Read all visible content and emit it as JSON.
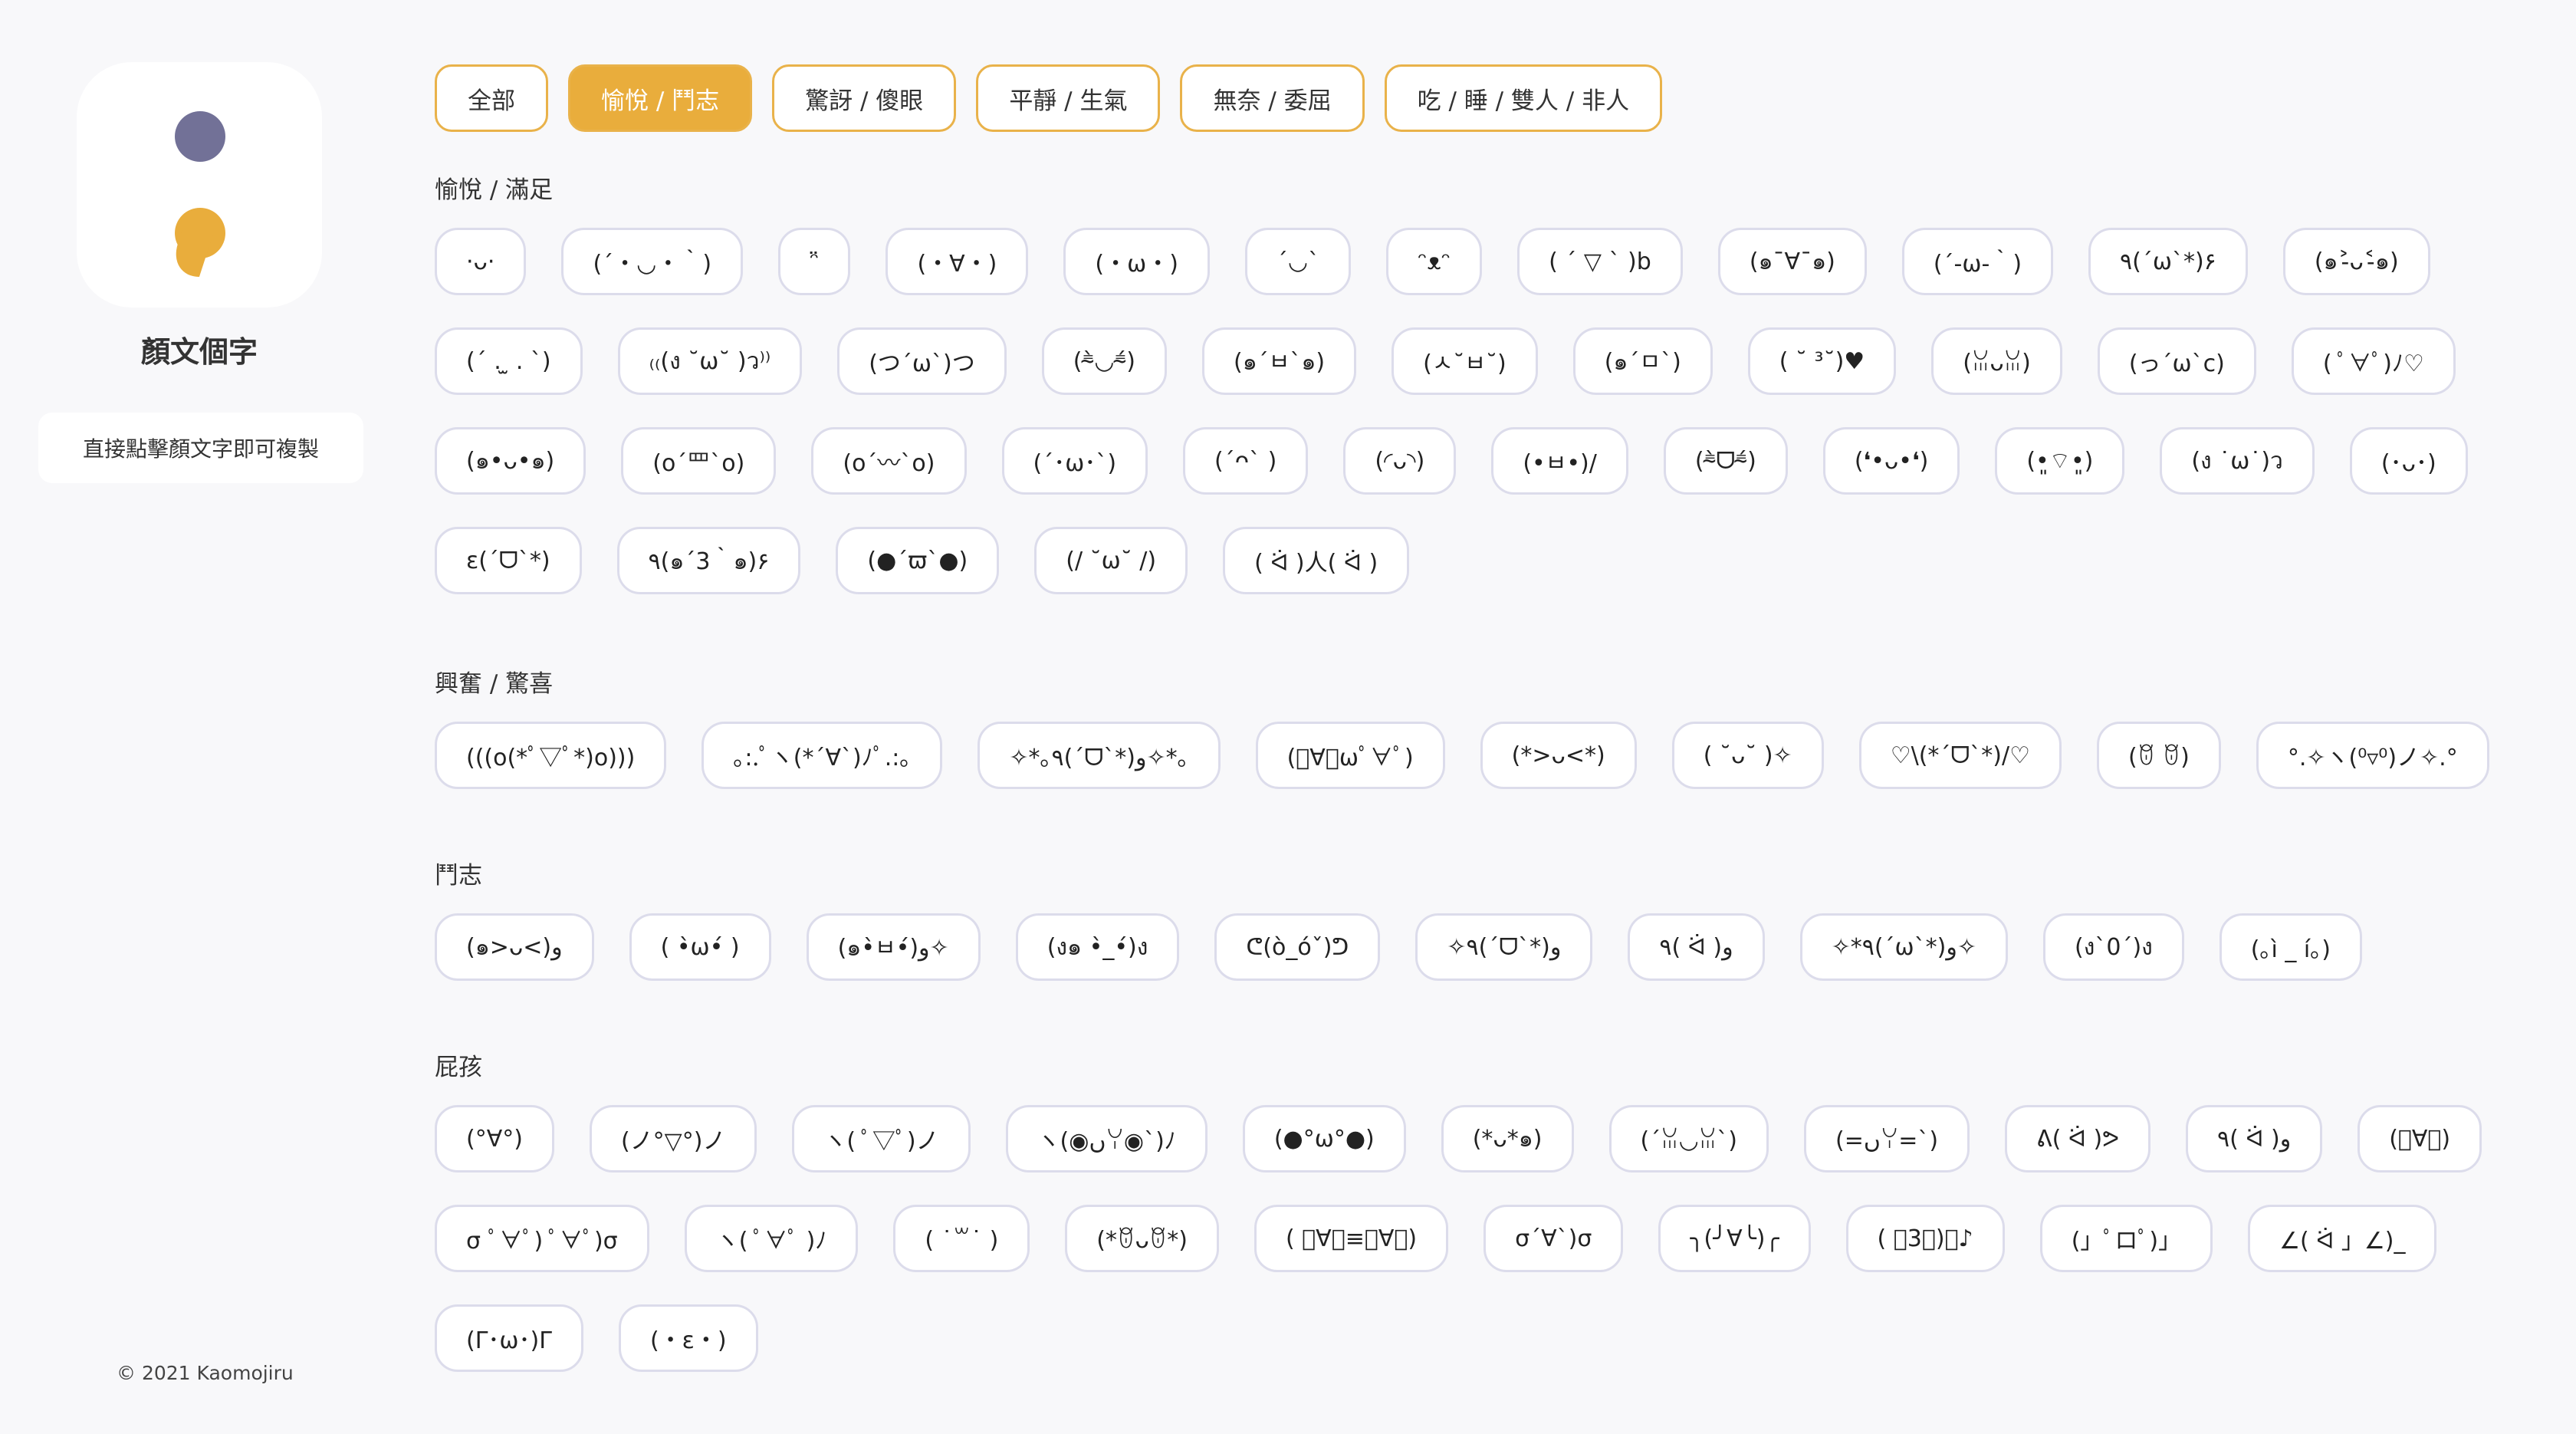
{
  "colors": {
    "accent": "#e9ad3c",
    "logo_dot": "#727197",
    "chip_border": "#dcdceb"
  },
  "app": {
    "name": "顏文個字",
    "hint": "直接點擊顏文字即可複製",
    "copyright": "© 2021 Kaomojiru"
  },
  "tabs": [
    "全部",
    "愉悅 / 鬥志",
    "驚訝 / 傻眼",
    "平靜 / 生氣",
    "無奈 / 委屈",
    "吃 / 睡 / 雙人 / 非人"
  ],
  "sections": [
    {
      "title": "愉悅 / 滿足",
      "items": [
        "·ᴗ·",
        "(´・◡・｀)",
        "ᵔ̈",
        "(・∀・)",
        "(・ω・)",
        "´◡`",
        "ᵔᴥᵔ",
        "( ´ ▽ ` )b",
        "(๑¯∀¯๑)",
        "(´-ω-｀)",
        "٩(´ω`*)۶",
        "(๑˃̵ᴗ˂̵๑)",
        "(´ . ̫ . `)",
        "₍₍(ง ˘ω˘ )ว⁾⁾",
        "(つ´ω`)つ",
        "(⁼̴̀◡⁼̴́)",
        "(๑´ㅂ`๑)",
        "(ㅅ˘ㅂ˘)",
        "(๑´ㅁ`)",
        "( ˘ ³˘)♥",
        "(ꈍᴗꈍ)",
        "(っ´ω`c)",
        "( ﾟ∀ﾟ)ﾉ♡",
        "(๑•ᴗ•๑)",
        "(o´罒`o)",
        "(o´〰`o)",
        "(´･ω･`)",
        "(´ᴖ` )",
        "(◜ᴗ◝)",
        "(•ㅂ•)/",
        "(⁼̴̀ᗜ⁼̴́)",
        "(❛•ᴗ•❛)",
        "(•͈⌔•͈)",
        "(ง ˙ω˙)ว",
        "(･ᴗ･)",
        "ɛ(ˊᗜˋ*)",
        "٩(๑´3｀๑)۶",
        "(●´ϖ`●)",
        "(/ ˘ω˘ /)",
        "( ᐛ )人( ᐛ )"
      ]
    },
    {
      "title": "興奮 / 驚喜",
      "items": [
        "(((o(*ﾟ▽ﾟ*)o)))",
        "｡:.ﾟヽ(*´∀`)ﾉﾟ.:｡",
        "✧*｡٩(ˊᗜˋ*)و✧*｡",
        "(ﾟ∀ﾟωﾟ∀ﾟ)",
        "(*>ᴗ<*)",
        "( ˘ᴗ˘ )✧",
        "♡\\(*ˊᗜˋ*)/♡",
        "(ꆤ ꆤ)",
        "°.✧ヽ(⁰▿⁰)ノ✧.°"
      ]
    },
    {
      "title": "鬥志",
      "items": [
        "(๑>ᴗ<)و",
        "( •̀ω•́ )",
        "(๑•̀ㅂ•́)و✧",
        "(ง๑ •̀_•́)ง",
        "ᕦ(ò_óˇ)ᕤ",
        "✧٩(ˊᗜˋ*)و",
        "٩( ᐛ )و",
        "✧*٩(ˊωˋ*)و✧",
        "(ง`0´)ง",
        "(｡ì _ í｡)"
      ]
    },
    {
      "title": "屁孩",
      "items": [
        "(°∀°)",
        "(ノ°▽°)ノ",
        "ヽ( ﾟ▽ﾟ)ノ",
        "ヽ(◉ںꌩ◉`)ﾉ",
        "(●°ω°●)",
        "(*ᴗ*๑)",
        "(´ꈍ◡ꈍ`)",
        "(=ںꌩ=`)",
        "ᕕ( ᐛ )ᕗ",
        "٩( ᐛ )و",
        "(ﾟ∀ﾟ)",
        "σ ﾟ∀ﾟ) ﾟ∀ﾟ)σ",
        "ヽ( ﾟ∀ﾟ )ﾉ",
        "( ˙꒳˙ )",
        "(*ꆤᴗꆤ*)",
        "( ﾟ∀ﾟ≡ﾟ∀ﾟ)",
        "σ´∀`)σ",
        "╮(╯∀╰)╭",
        "( ﾟ3ﾟ)〜♪",
        "(」ﾟロﾟ)」",
        "∠( ᐛ 」∠)_",
        "(Γ･ω･)Γ",
        "(・ε・)"
      ]
    }
  ]
}
